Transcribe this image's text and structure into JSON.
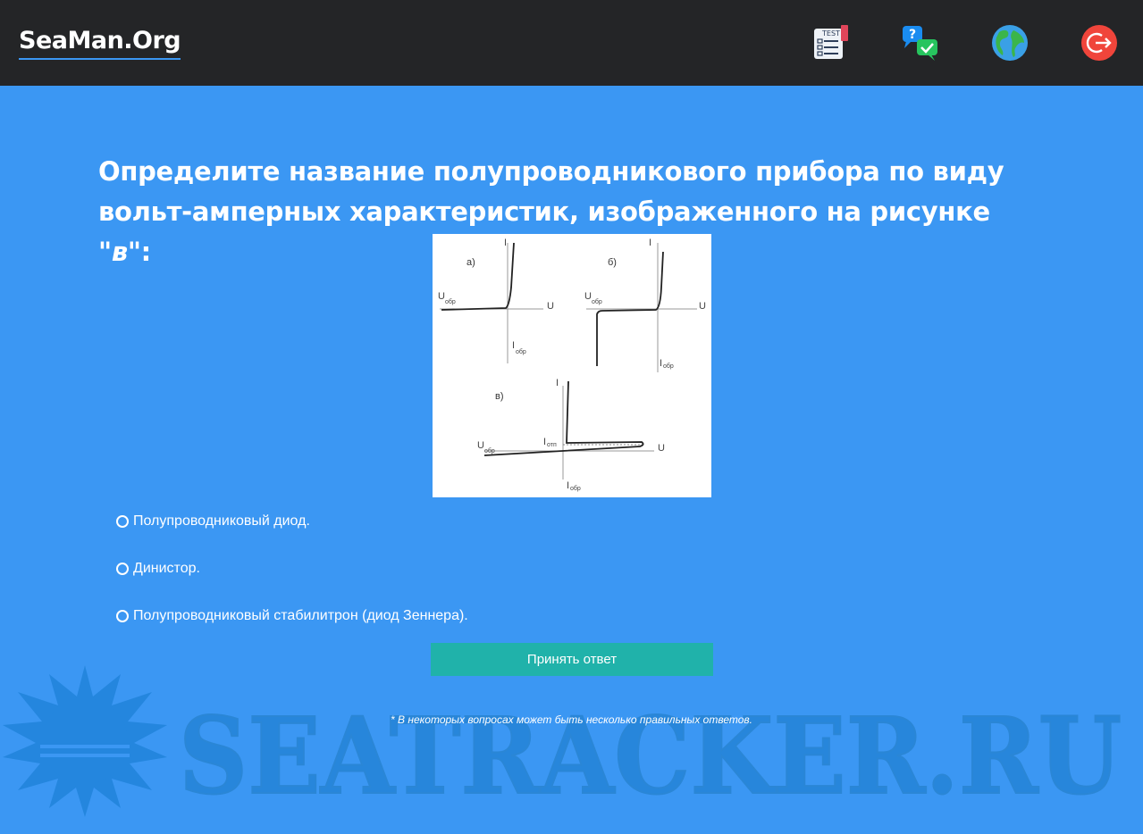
{
  "header": {
    "brand": "SeaMan.Org",
    "icons": [
      "test-icon",
      "questions-chat-icon",
      "globe-icon",
      "logout-icon"
    ],
    "test_icon_text": "TEST"
  },
  "question": {
    "text_before": "Определите название полупроводникового прибора по виду вольт-амперных характеристик, изображенного на рисунке \"",
    "highlight": "в",
    "text_after": "\":"
  },
  "figure": {
    "a_label": "а)",
    "b_label": "б)",
    "v_label": "в)",
    "axis_i": "I",
    "axis_u": "U",
    "u_rev": "U",
    "u_rev_sub": "обр",
    "i_rev": "I",
    "i_rev_sub": "обр",
    "i_off": "I",
    "i_off_sub": "отп"
  },
  "answers": [
    {
      "label": "Полупроводниковый диод.",
      "selected": false
    },
    {
      "label": "Динистор.",
      "selected": false
    },
    {
      "label": "Полупроводниковый стабилитрон (диод Зеннера).",
      "selected": false
    }
  ],
  "submit_label": "Принять ответ",
  "note": "* В некоторых вопросах может быть несколько правильных ответов.",
  "watermark": "SEATRACKER.RU",
  "colors": {
    "background": "#3b97f3",
    "topbar": "#242527",
    "button": "#20b2aa",
    "watermark": "#1f7fd0"
  }
}
